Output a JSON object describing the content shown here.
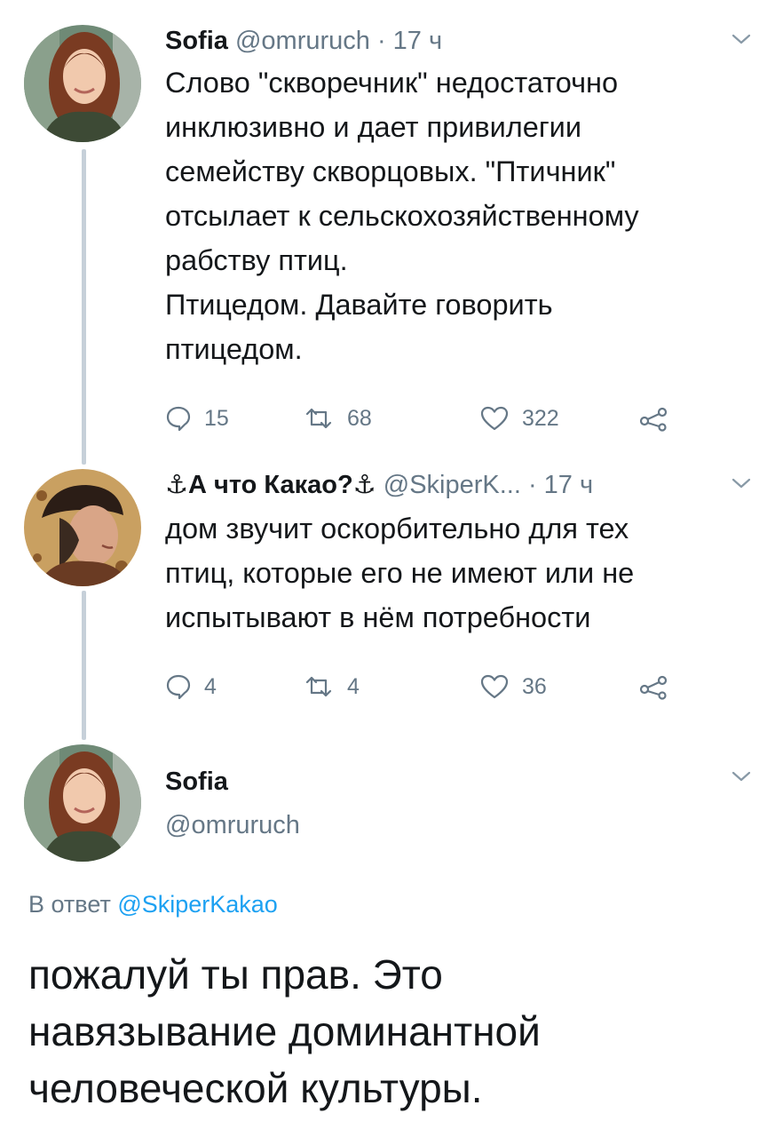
{
  "tweet1": {
    "name": "Sofia",
    "handle": "@omruruch",
    "time": "· 17 ч",
    "text": "Слово \"скворечник\" недостаточно\nинклюзивно и дает привилегии\nсемейству скворцовых. \"Птичник\"\nотсылает к сельскохозяйственному\nрабству птиц.\nПтицедом. Давайте говорить\nптицедом.",
    "replies": "15",
    "retweets": "68",
    "likes": "322"
  },
  "tweet2": {
    "name": "⚓А что Какао?⚓",
    "handle": "@SkiperK...",
    "time": "· 17 ч",
    "text": "дом звучит оскорбительно для тех\nптиц, которые его не имеют или не\nиспытывают в нём потребности",
    "replies": "4",
    "retweets": "4",
    "likes": "36"
  },
  "tweet3": {
    "name": "Sofia",
    "handle": "@omruruch",
    "reply_prefix": "В ответ ",
    "reply_to": "@SkiperKakao",
    "text": "пожалуй ты прав. Это\nнавязывание доминантной\nчеловеческой культуры."
  },
  "icons": {
    "reply": "reply-icon",
    "retweet": "retweet-icon",
    "like": "heart-icon",
    "share": "share-icon",
    "caret": "chevron-down-icon"
  },
  "colors": {
    "text": "#14171a",
    "secondary": "#657786",
    "link": "#1da1f2",
    "thread": "#c6d0d9"
  }
}
